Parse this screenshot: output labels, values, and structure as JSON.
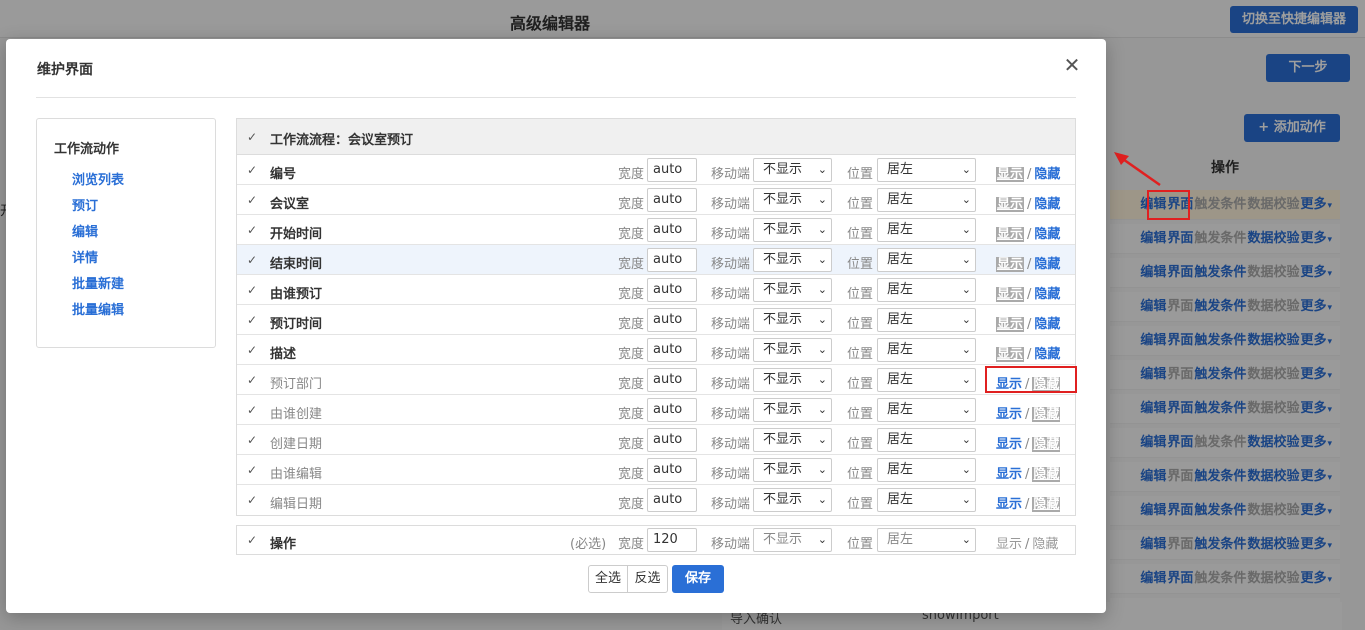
{
  "background": {
    "title": "高级编辑器",
    "switch_button": "切换至快捷编辑器",
    "next_button": "下一步",
    "add_action_button": "+ 添加动作",
    "left_cut_text": "开",
    "operations_header": "操作",
    "op_labels": {
      "edit": "编辑",
      "ui": "界面",
      "trigger": "触发条件",
      "validate": "数据校验",
      "more": "更多"
    },
    "bottom_row": {
      "col1": "导入确认",
      "col2": "showImport"
    }
  },
  "modal": {
    "title": "维护界面",
    "close_icon": "close-icon",
    "side": {
      "title": "工作流动作",
      "items": [
        "浏览列表",
        "预订",
        "编辑",
        "详情",
        "批量新建",
        "批量编辑"
      ]
    },
    "table": {
      "header": "工作流流程：会议室预订",
      "width_label": "宽度",
      "mobile_label": "移动端",
      "position_label": "位置",
      "show_label": "显示",
      "hide_label": "隐藏",
      "separator": "/",
      "rows": [
        {
          "name": "编号",
          "width": "auto",
          "mobile": "不显示",
          "position": "居左",
          "visible": true
        },
        {
          "name": "会议室",
          "width": "auto",
          "mobile": "不显示",
          "position": "居左",
          "visible": true
        },
        {
          "name": "开始时间",
          "width": "auto",
          "mobile": "不显示",
          "position": "居左",
          "visible": true
        },
        {
          "name": "结束时间",
          "width": "auto",
          "mobile": "不显示",
          "position": "居左",
          "visible": true
        },
        {
          "name": "由谁预订",
          "width": "auto",
          "mobile": "不显示",
          "position": "居左",
          "visible": true
        },
        {
          "name": "预订时间",
          "width": "auto",
          "mobile": "不显示",
          "position": "居左",
          "visible": true
        },
        {
          "name": "描述",
          "width": "auto",
          "mobile": "不显示",
          "position": "居左",
          "visible": true
        },
        {
          "name": "预订部门",
          "width": "auto",
          "mobile": "不显示",
          "position": "居左",
          "visible": false
        },
        {
          "name": "由谁创建",
          "width": "auto",
          "mobile": "不显示",
          "position": "居左",
          "visible": false
        },
        {
          "name": "创建日期",
          "width": "auto",
          "mobile": "不显示",
          "position": "居左",
          "visible": false
        },
        {
          "name": "由谁编辑",
          "width": "auto",
          "mobile": "不显示",
          "position": "居左",
          "visible": false
        },
        {
          "name": "编辑日期",
          "width": "auto",
          "mobile": "不显示",
          "position": "居左",
          "visible": false
        }
      ]
    },
    "actions_row": {
      "name": "操作",
      "required": "(必选)",
      "width": "120",
      "mobile": "不显示",
      "position": "居左"
    },
    "buttons": {
      "select_all": "全选",
      "invert": "反选",
      "save": "保存"
    }
  }
}
